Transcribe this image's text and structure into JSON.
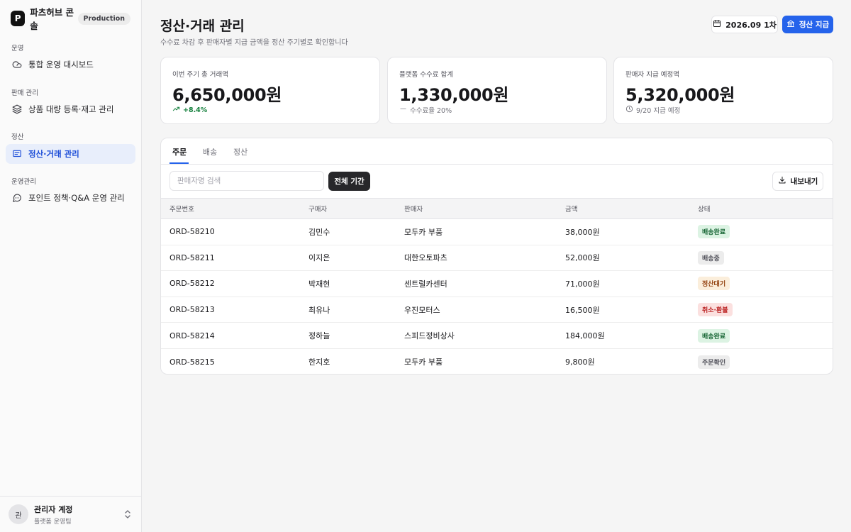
{
  "sidebar": {
    "brand_initial": "P",
    "brand_name": "파츠허브 콘솔",
    "env_badge": "Production",
    "sections": [
      {
        "label": "운영",
        "item": "통합 운영 대시보드",
        "icon": "cloud-icon"
      },
      {
        "label": "판매 관리",
        "item": "상품 대량 등록·재고 관리",
        "icon": "layers-icon"
      },
      {
        "label": "정산",
        "item": "정산·거래 관리",
        "icon": "message-square-icon"
      },
      {
        "label": "운영관리",
        "item": "포인트 정책·Q&A 운영 관리",
        "icon": "message-circle-icon"
      }
    ],
    "active_item": "정산·거래 관리",
    "user": {
      "initial": "관",
      "name": "관리자 계정",
      "team": "플랫폼 운영팀"
    }
  },
  "header": {
    "title": "정산·거래 관리",
    "subtitle": "수수료 차감 후 판매자별 지급 금액을 정산 주기별로 확인합니다",
    "cycle_button": "2026.09 1차",
    "pay_button": "정산 지급"
  },
  "cards": [
    {
      "label": "이번 주기 총 거래액",
      "value": "6,650,000원",
      "foot": "+8.4%",
      "foot_icon": "trending-up-icon"
    },
    {
      "label": "플랫폼 수수료 합계",
      "value": "1,330,000원",
      "foot": "수수료율 20%",
      "foot_icon": "minus-icon"
    },
    {
      "label": "판매자 지급 예정액",
      "value": "5,320,000원",
      "foot": "9/20 지급 예정",
      "foot_icon": "clock-icon"
    }
  ],
  "tabs": [
    "주문",
    "배송",
    "정산"
  ],
  "active_tab": "주문",
  "toolbar": {
    "search_placeholder": "판매자명 검색",
    "search_value": "",
    "period_button": "전체 기간",
    "export_button": "내보내기"
  },
  "table": {
    "headers": [
      "주문번호",
      "구매자",
      "판매자",
      "금액",
      "상태"
    ],
    "rows": [
      {
        "order": "ORD-58210",
        "buyer": "김민수",
        "seller": "모두카 부품",
        "amount": "38,000원",
        "status": "배송완료",
        "tone": "green"
      },
      {
        "order": "ORD-58211",
        "buyer": "이지은",
        "seller": "대한오토파츠",
        "amount": "52,000원",
        "status": "배송중",
        "tone": "gray"
      },
      {
        "order": "ORD-58212",
        "buyer": "박재현",
        "seller": "센트럴카센터",
        "amount": "71,000원",
        "status": "정산대기",
        "tone": "amber"
      },
      {
        "order": "ORD-58213",
        "buyer": "최유나",
        "seller": "우진모터스",
        "amount": "16,500원",
        "status": "취소·환불",
        "tone": "red"
      },
      {
        "order": "ORD-58214",
        "buyer": "정하늘",
        "seller": "스피드정비상사",
        "amount": "184,000원",
        "status": "배송완료",
        "tone": "green"
      },
      {
        "order": "ORD-58215",
        "buyer": "한지호",
        "seller": "모두카 부품",
        "amount": "9,800원",
        "status": "주문확인",
        "tone": "gray"
      }
    ]
  },
  "colors": {
    "accent": "#2563eb",
    "success": "#15803d",
    "dark_button": "#27272a"
  }
}
